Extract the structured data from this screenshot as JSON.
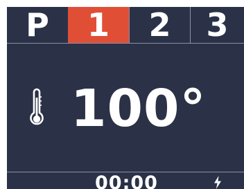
{
  "tabs": [
    {
      "label": "P",
      "active": false
    },
    {
      "label": "1",
      "active": true
    },
    {
      "label": "2",
      "active": false
    },
    {
      "label": "3",
      "active": false
    }
  ],
  "temperature": {
    "icon": "thermometer-icon",
    "value": "100°"
  },
  "status": {
    "timer": "00:00",
    "power_icon": "lightning-bolt-icon"
  },
  "colors": {
    "background": "#2b3247",
    "active_tab": "#e04e36",
    "text": "#ffffff",
    "divider": "#8b92a6"
  }
}
